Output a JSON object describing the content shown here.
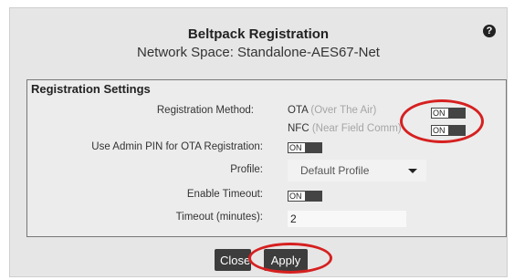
{
  "dialog": {
    "title": "Beltpack Registration",
    "subtitle": "Network Space: Standalone-AES67-Net",
    "help_icon": "question-circle-icon"
  },
  "settings": {
    "header": "Registration Settings",
    "registration_method_label": "Registration Method:",
    "ota": {
      "name": "OTA",
      "desc": "(Over The Air)",
      "toggle": "ON"
    },
    "nfc": {
      "name": "NFC",
      "desc": "(Near Field Comm)",
      "toggle": "ON"
    },
    "admin_pin_label": "Use Admin PIN for OTA Registration:",
    "admin_pin_toggle": "ON",
    "profile_label": "Profile:",
    "profile_value": "Default Profile",
    "enable_timeout_label": "Enable Timeout:",
    "enable_timeout_toggle": "ON",
    "timeout_label": "Timeout (minutes):",
    "timeout_value": "2"
  },
  "buttons": {
    "close": "Close",
    "apply": "Apply"
  },
  "colors": {
    "highlight": "#d62020",
    "button_bg": "#3d3d3d"
  }
}
